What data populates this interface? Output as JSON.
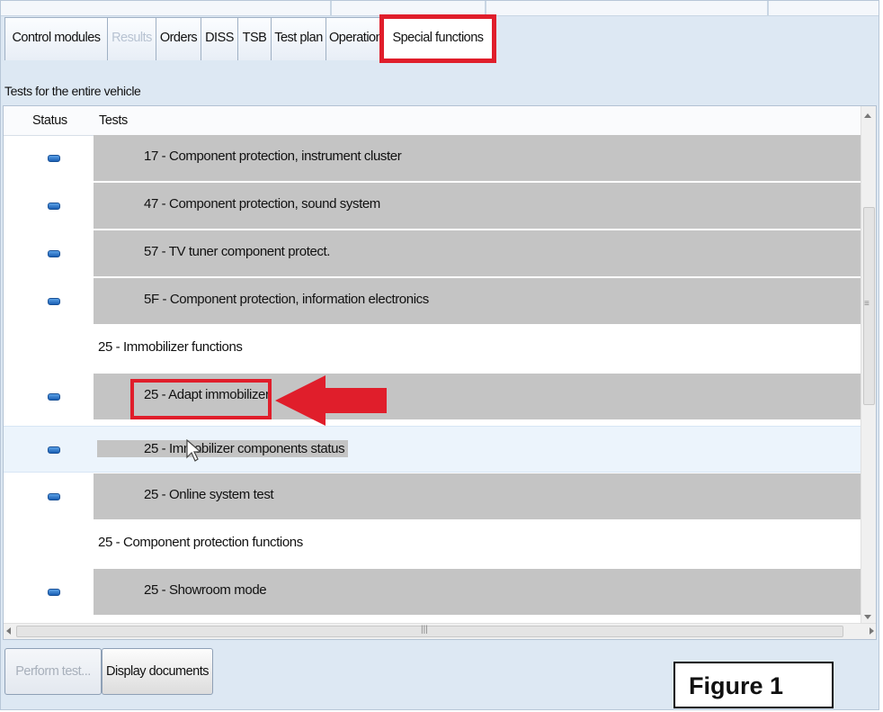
{
  "tabs": [
    {
      "label": "Control modules",
      "state": "normal"
    },
    {
      "label": "Results",
      "state": "disabled"
    },
    {
      "label": "Orders",
      "state": "normal"
    },
    {
      "label": "DISS",
      "state": "normal"
    },
    {
      "label": "TSB",
      "state": "normal"
    },
    {
      "label": "Test plan",
      "state": "normal"
    },
    {
      "label": "Operation",
      "state": "normal"
    },
    {
      "label": "Special functions",
      "state": "active-highlighted"
    }
  ],
  "section_title": "Tests for the entire vehicle",
  "table": {
    "columns": [
      "Status",
      "Tests"
    ],
    "rows": [
      {
        "type": "item",
        "status_icon": "blue-status-icon",
        "text": "17 - Component protection, instrument cluster"
      },
      {
        "type": "item",
        "status_icon": "blue-status-icon",
        "text": "47 - Component protection, sound system"
      },
      {
        "type": "item",
        "status_icon": "blue-status-icon",
        "text": "57 - TV tuner component protect."
      },
      {
        "type": "item",
        "status_icon": "blue-status-icon",
        "text": "5F - Component protection, information electronics"
      },
      {
        "type": "group",
        "text": "25 - Immobilizer functions"
      },
      {
        "type": "item",
        "status_icon": "blue-status-icon",
        "text": "25 - Adapt immobilizer",
        "highlighted": true
      },
      {
        "type": "item",
        "status_icon": "blue-status-icon",
        "text": "25 - Immobilizer components status",
        "selected": true
      },
      {
        "type": "item",
        "status_icon": "blue-status-icon",
        "text": "25 - Online system test"
      },
      {
        "type": "group",
        "text": "25 - Component protection functions"
      },
      {
        "type": "item",
        "status_icon": "blue-status-icon",
        "text": "25 - Showroom mode"
      }
    ]
  },
  "buttons": {
    "perform_test": "Perform test...",
    "display_documents": "Display documents"
  },
  "figure_label": "Figure 1",
  "colors": {
    "highlight_red": "#e01e2b",
    "row_gray": "#c4c4c4",
    "panel_blue": "#dde8f3",
    "status_blue": "#1a5fb4"
  }
}
